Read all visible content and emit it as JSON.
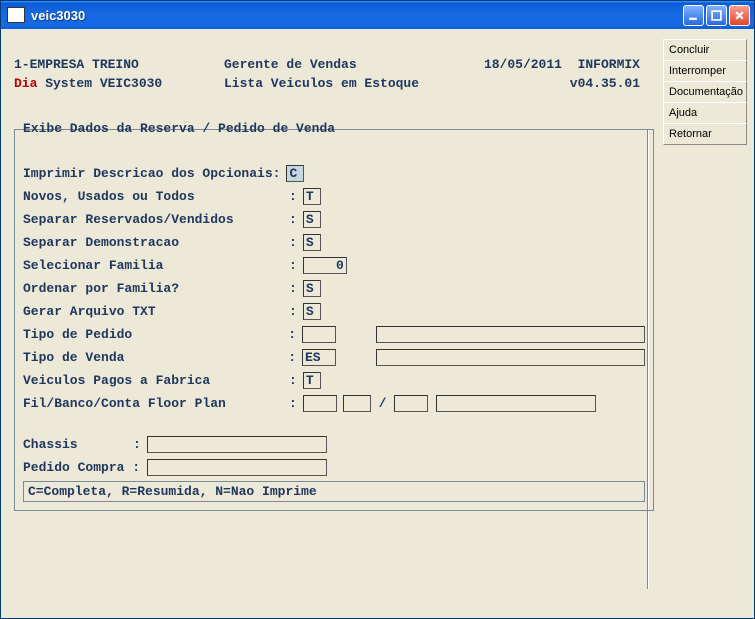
{
  "window": {
    "title": "veic3030"
  },
  "side": {
    "concluir": "Concluir",
    "interromper": "Interromper",
    "documentacao": "Documentação",
    "ajuda": "Ajuda",
    "retornar": "Retornar"
  },
  "hdr": {
    "empresa": "1-EMPRESA TREINO",
    "role": "Gerente de Vendas",
    "date": "18/05/2011",
    "db": "INFORMIX",
    "dia": "Dia",
    "system": " System  VEIC3030",
    "subtitle": "Lista Veiculos em Estoque",
    "version": "v04.35.01"
  },
  "group": {
    "legend": "Exibe Dados da Reserva / Pedido de Venda"
  },
  "labels": {
    "l1": "Imprimir Descricao dos Opcionais:",
    "l2": "Novos, Usados ou Todos",
    "l3": "Separar Reservados/Vendidos",
    "l4": "Separar Demonstracao",
    "l5": "Selecionar Familia",
    "l6": "Ordenar por Familia?",
    "l7": "Gerar Arquivo TXT",
    "l8": "Tipo de Pedido",
    "l9": "Tipo de Venda",
    "l10": "Veiculos Pagos a Fabrica",
    "l11": "Fil/Banco/Conta Floor Plan",
    "l12": "Chassis",
    "l13": "Pedido Compra :",
    "colon": ":",
    "slash": "/"
  },
  "vals": {
    "opc": "C",
    "nut": "T",
    "resv": "S",
    "demo": "S",
    "fam": "0",
    "ordfam": "S",
    "txt": "S",
    "tpedido": "",
    "tpedido_desc": "",
    "tvenda": "ES",
    "tvenda_desc": "",
    "pagos": "T",
    "fil": "",
    "banco": "",
    "conta": "",
    "conta_desc": "",
    "chassis": "",
    "pedido_compra": ""
  },
  "hint": "C=Completa, R=Resumida, N=Nao Imprime"
}
